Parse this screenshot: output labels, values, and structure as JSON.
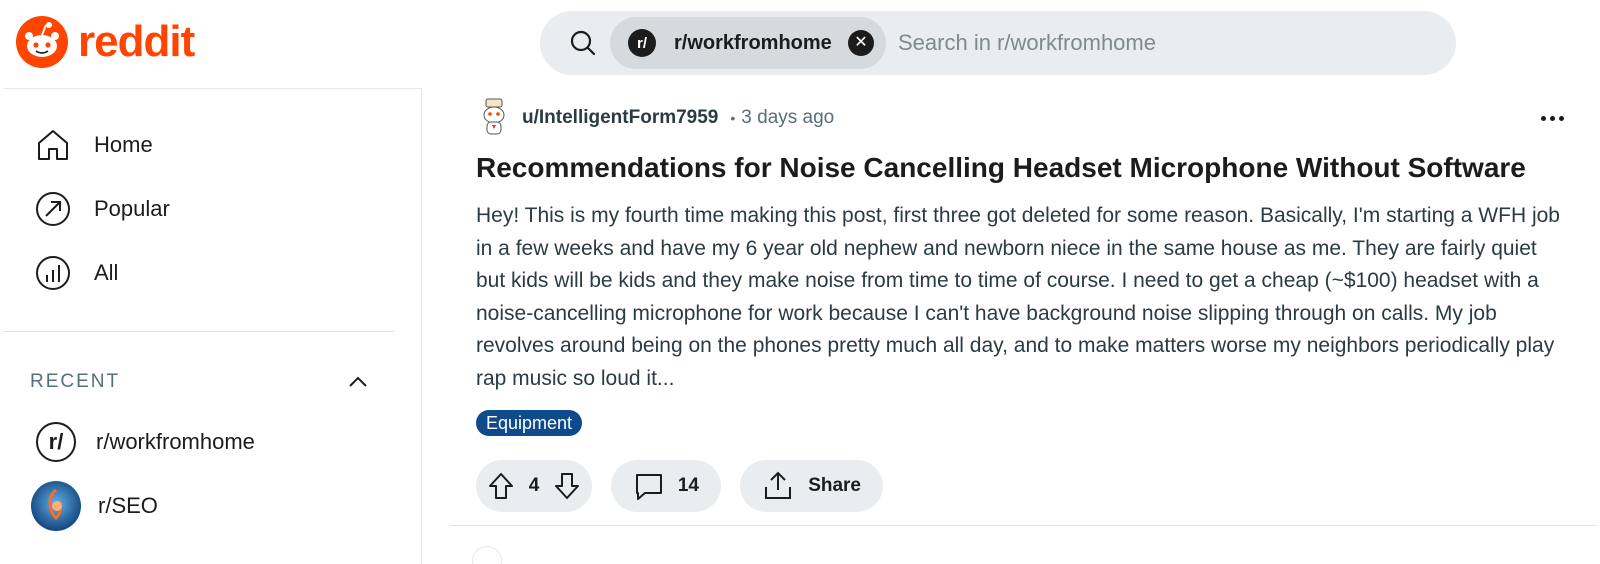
{
  "brand": {
    "name": "reddit",
    "color": "#ff4500",
    "logo_icon": "reddit-snoo-icon"
  },
  "search": {
    "icon": "search-icon",
    "chip_label": "r/workfromhome",
    "chip_icon_text": "r/",
    "placeholder": "Search in r/workfromhome",
    "value": ""
  },
  "sidebar": {
    "nav": [
      {
        "label": "Home",
        "icon": "home-icon"
      },
      {
        "label": "Popular",
        "icon": "popular-arrow-icon"
      },
      {
        "label": "All",
        "icon": "all-chart-icon"
      }
    ],
    "recent_title": "RECENT",
    "recent_collapse_icon": "chevron-up-icon",
    "recent": [
      {
        "label": "r/workfromhome",
        "avatar_text": "r/"
      },
      {
        "label": "r/SEO"
      }
    ]
  },
  "post": {
    "author": "u/IntelligentForm7959",
    "separator": "•",
    "time": "3 days ago",
    "more_icon": "more-options-icon",
    "title": "Recommendations for Noise Cancelling Headset Microphone Without Software",
    "body": "Hey! This is my fourth time making this post, first three got deleted for some reason. Basically, I'm starting a WFH job in a few weeks and have my 6 year old nephew and newborn niece in the same house as me. They are fairly quiet but kids will be kids and they make noise from time to time of course. I need to get a cheap (~$100) headset with a noise-cancelling microphone for work because I can't have background noise slipping through on calls. My job revolves around being on the phones pretty much all day, and to make matters worse my neighbors periodically play rap music so loud it...",
    "flair": "Equipment",
    "flair_color": "#0e4a8c",
    "votes": "4",
    "comments": "14",
    "share_label": "Share"
  }
}
